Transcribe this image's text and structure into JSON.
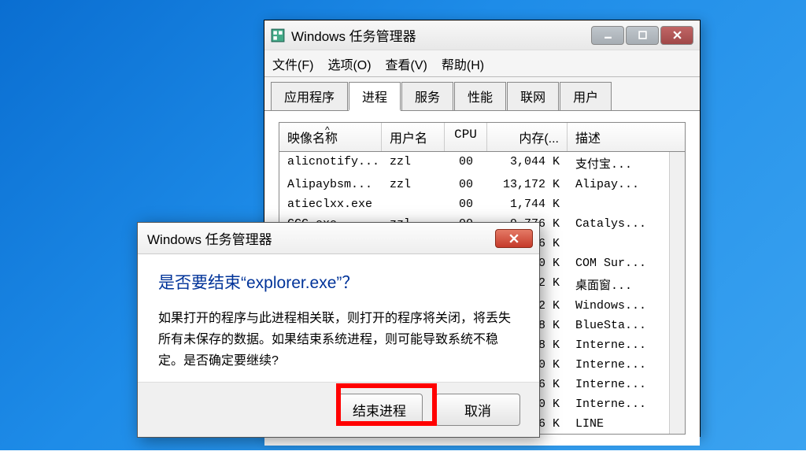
{
  "task_manager": {
    "title": "Windows 任务管理器",
    "menu": [
      "文件(F)",
      "选项(O)",
      "查看(V)",
      "帮助(H)"
    ],
    "tabs": [
      "应用程序",
      "进程",
      "服务",
      "性能",
      "联网",
      "用户"
    ],
    "active_tab": 1,
    "columns": {
      "name": "映像名称",
      "user": "用户名",
      "cpu": "CPU",
      "mem": "内存(...",
      "desc": "描述"
    },
    "rows": [
      {
        "name": "alicnotify...",
        "user": "zzl",
        "cpu": "00",
        "mem": "3,044 K",
        "desc": "支付宝..."
      },
      {
        "name": "Alipaybsm...",
        "user": "zzl",
        "cpu": "00",
        "mem": "13,172 K",
        "desc": "Alipay..."
      },
      {
        "name": "atieclxx.exe",
        "user": "",
        "cpu": "00",
        "mem": "1,744 K",
        "desc": ""
      },
      {
        "name": "CCC.exe",
        "user": "zzl",
        "cpu": "00",
        "mem": "9,776 K",
        "desc": "Catalys..."
      },
      {
        "name": "",
        "user": "",
        "cpu": "",
        "mem": "56 K",
        "desc": ""
      },
      {
        "name": "",
        "user": "",
        "cpu": "",
        "mem": "60 K",
        "desc": "COM Sur..."
      },
      {
        "name": "",
        "user": "",
        "cpu": "",
        "mem": "32 K",
        "desc": "桌面窗..."
      },
      {
        "name": "",
        "user": "",
        "cpu": "",
        "mem": "72 K",
        "desc": "Windows..."
      },
      {
        "name": "",
        "user": "",
        "cpu": "",
        "mem": "48 K",
        "desc": "BlueSta..."
      },
      {
        "name": "",
        "user": "",
        "cpu": "",
        "mem": "08 K",
        "desc": "Interne..."
      },
      {
        "name": "",
        "user": "",
        "cpu": "",
        "mem": "80 K",
        "desc": "Interne..."
      },
      {
        "name": "",
        "user": "",
        "cpu": "",
        "mem": "96 K",
        "desc": "Interne..."
      },
      {
        "name": "",
        "user": "",
        "cpu": "",
        "mem": "20 K",
        "desc": "Interne..."
      },
      {
        "name": "",
        "user": "",
        "cpu": "",
        "mem": "36 K",
        "desc": "LINE"
      }
    ]
  },
  "dialog": {
    "title": "Windows 任务管理器",
    "heading": "是否要结束“explorer.exe”？",
    "body": "如果打开的程序与此进程相关联，则打开的程序将关闭，将丢失所有未保存的数据。如果结束系统进程，则可能导致系统不稳定。是否确定要继续?",
    "confirm": "结束进程",
    "cancel": "取消"
  }
}
